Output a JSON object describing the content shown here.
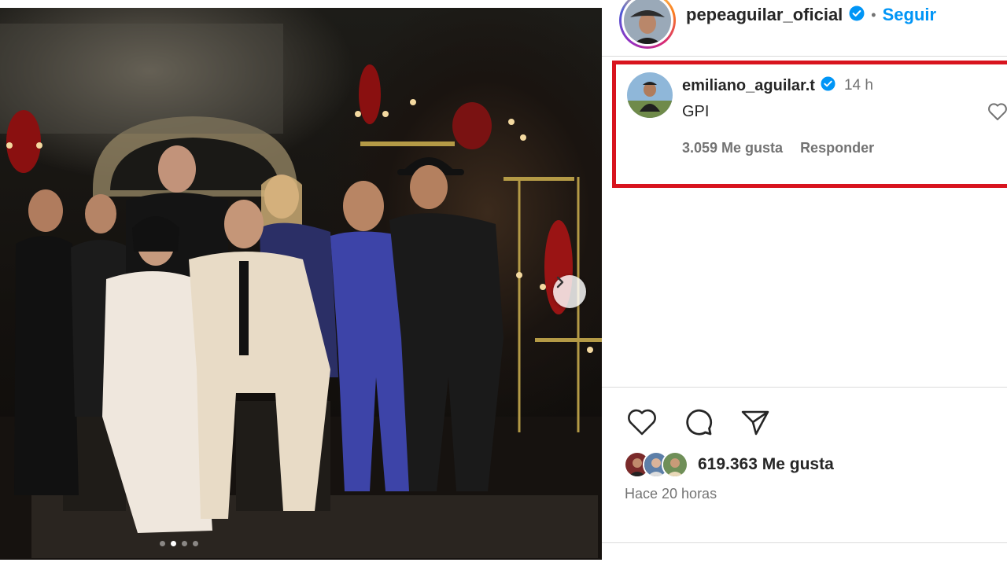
{
  "post": {
    "owner": {
      "username": "pepeaguilar_oficial",
      "verified": true,
      "separator": "•",
      "follow_label": "Seguir"
    },
    "carousel": {
      "total_slides": 4,
      "active_slide": 2,
      "next_icon": "chevron-right-icon"
    },
    "highlighted_comment": {
      "username": "emiliano_aguilar.t",
      "verified": true,
      "time": "14 h",
      "text": "GPI",
      "likes_label": "3.059 Me gusta",
      "reply_label": "Responder",
      "highlight_color": "#d8141e"
    },
    "actions": {
      "like_icon": "heart-icon",
      "comment_icon": "comment-icon",
      "share_icon": "send-icon"
    },
    "likes_label": "619.363 Me gusta",
    "posted_label": "Hace 20 horas"
  },
  "colors": {
    "link_blue": "#0095f6",
    "text_secondary": "#737373",
    "verified_blue": "#0095f6"
  }
}
